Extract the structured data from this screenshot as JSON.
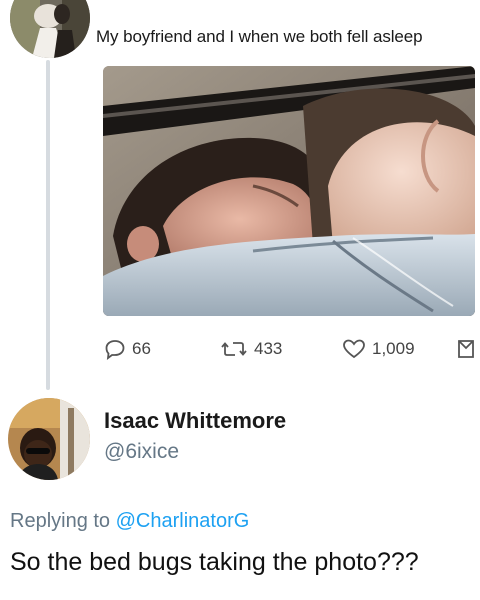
{
  "original_tweet": {
    "text": "My boyfriend and I when we both fell asleep",
    "photo_icon": "sleeping-couple-photo",
    "actions": {
      "replies": "66",
      "retweets": "433",
      "likes": "1,009"
    }
  },
  "reply_tweet": {
    "display_name": "Isaac Whittemore",
    "handle": "@6ixice",
    "replying_prefix": "Replying to",
    "replying_to": "@CharlinatorG",
    "text": "So the bed bugs taking the photo???"
  },
  "colors": {
    "mention": "#1da1f2",
    "secondary_text": "#657786",
    "thread_line": "#d6dbe0"
  }
}
